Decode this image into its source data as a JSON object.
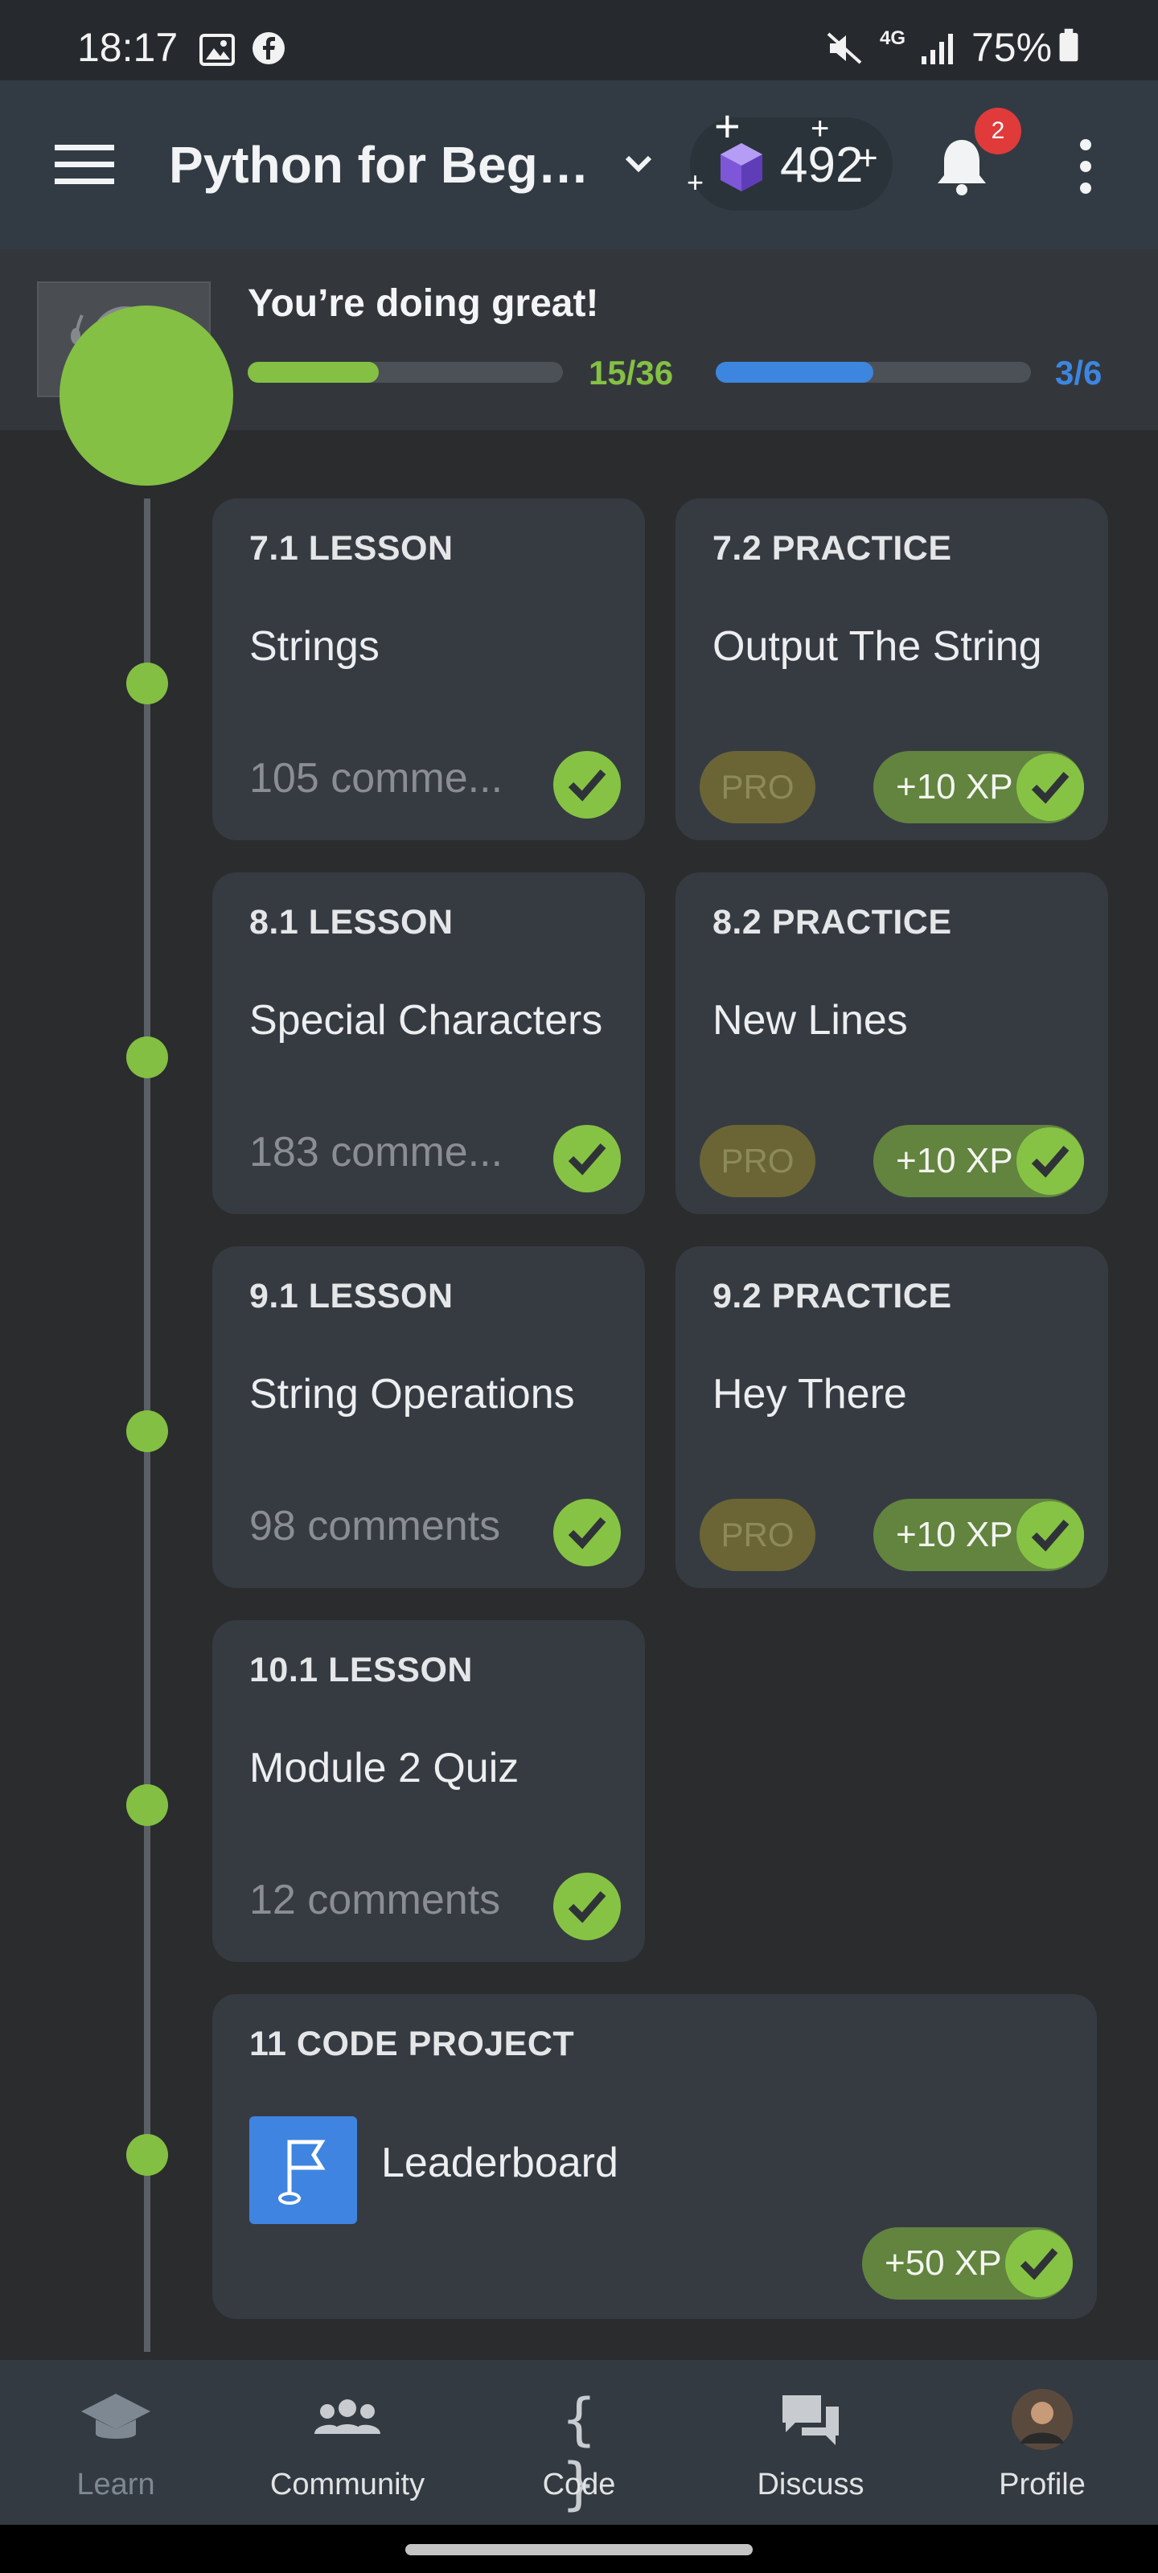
{
  "status_bar": {
    "time": "18:17",
    "network": "4G",
    "battery": "75%",
    "icons": [
      "gallery-icon",
      "facebook-icon",
      "mute-icon",
      "signal-icon",
      "battery-icon"
    ]
  },
  "app_bar": {
    "course_title": "Python for Begin...",
    "gems": "492",
    "notification_count": "2"
  },
  "progress_panel": {
    "heading": "You’re doing great!",
    "bar1": {
      "label": "15/36",
      "fraction": 0.4167,
      "color": "#84c044"
    },
    "bar2": {
      "label": "3/6",
      "fraction": 0.5,
      "color": "#3d86e0"
    }
  },
  "lessons": [
    {
      "kind": "7.1 LESSON",
      "name": "Strings",
      "comments": "105 comme..."
    },
    {
      "kind": "8.1 LESSON",
      "name": "Special Characters",
      "comments": "183 comme..."
    },
    {
      "kind": "9.1 LESSON",
      "name": "String Operations",
      "comments": "98 comments"
    },
    {
      "kind": "10.1 LESSON",
      "name": "Module 2 Quiz",
      "comments": "12 comments"
    }
  ],
  "practices": [
    {
      "kind": "7.2 PRACTICE",
      "name": "Output The String",
      "pro": "PRO",
      "xp": "+10 XP"
    },
    {
      "kind": "8.2 PRACTICE",
      "name": "New Lines",
      "pro": "PRO",
      "xp": "+10 XP"
    },
    {
      "kind": "9.2 PRACTICE",
      "name": "Hey There",
      "pro": "PRO",
      "xp": "+10 XP"
    }
  ],
  "code_project": {
    "kind": "11 CODE PROJECT",
    "name": "Leaderboard",
    "xp": "+50 XP"
  },
  "bottom_nav": [
    {
      "label": "Learn",
      "active": true
    },
    {
      "label": "Community"
    },
    {
      "label": "Code"
    },
    {
      "label": "Discuss"
    },
    {
      "label": "Profile"
    }
  ],
  "colors": {
    "accent_green": "#84c044",
    "accent_blue": "#3d86e0",
    "card": "#363b42",
    "background": "#2b2c2e"
  }
}
